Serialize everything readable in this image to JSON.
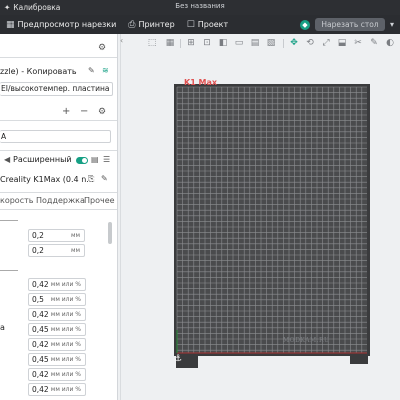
{
  "titlebar": {
    "tab_label": "Калибровка",
    "window_title": "Без названия"
  },
  "navbar": {
    "items": [
      {
        "label": "Предпросмотр нарезки",
        "icon": "preview-icon"
      },
      {
        "label": "Принтер",
        "icon": "printer-icon"
      },
      {
        "label": "Проект",
        "icon": "project-icon"
      }
    ],
    "slice_button": "Нарезать стол"
  },
  "sidebar": {
    "printer_name": "zzle) - Копировать",
    "plate_type": "EI/высокотемпер. пластина",
    "filament": "A",
    "advanced_label": "Расширенный",
    "process_profile": "Creality K1Max (0.4 n...",
    "tabs": [
      "корость",
      "Поддержка",
      "Прочее"
    ],
    "fields_mm": [
      {
        "value": "0,2",
        "unit": "мм"
      },
      {
        "value": "0,2",
        "unit": "мм"
      }
    ],
    "fields_pct": [
      {
        "value": "0,42",
        "unit": "мм или %"
      },
      {
        "value": "0,5",
        "unit": "мм или %"
      },
      {
        "value": "0,42",
        "unit": "мм или %"
      },
      {
        "value": "0,45",
        "unit": "мм или %"
      },
      {
        "value": "0,42",
        "unit": "мм или %"
      },
      {
        "value": "0,45",
        "unit": "мм или %"
      },
      {
        "value": "0,42",
        "unit": "мм или %"
      },
      {
        "value": "0,42",
        "unit": "мм или %"
      }
    ],
    "row_marker": "а"
  },
  "canvas": {
    "plate_label": "K1 Max",
    "watermark": "MODKAM.RU",
    "plate_color": "#4a4b4d",
    "grid_color": "#8d8f92",
    "accent": "#16a085"
  }
}
